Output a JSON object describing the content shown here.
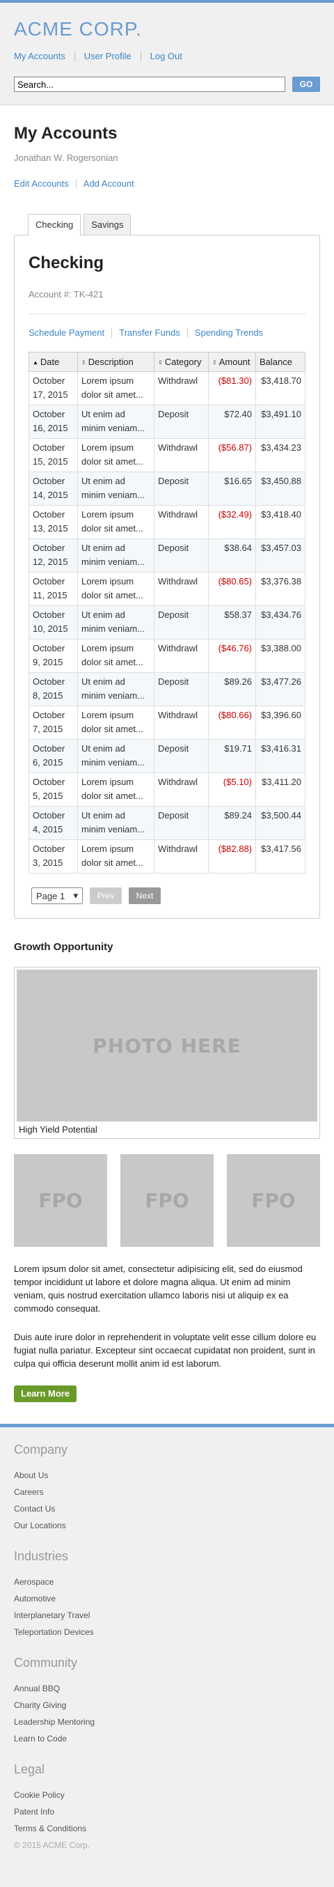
{
  "header": {
    "logo": "ACME CORP.",
    "nav": [
      "My Accounts",
      "User Profile",
      "Log Out"
    ],
    "search_value": "Search...",
    "go_label": "GO"
  },
  "page": {
    "title": "My Accounts",
    "user_name": "Jonathan W. Rogersonian",
    "account_links": [
      "Edit Accounts",
      "Add Account"
    ]
  },
  "tabs": [
    "Checking",
    "Savings"
  ],
  "panel": {
    "title": "Checking",
    "account_number": "Account #: TK-421",
    "links": [
      "Schedule Payment",
      "Transfer Funds",
      "Spending Trends"
    ]
  },
  "table": {
    "columns": [
      "Date",
      "Description",
      "Category",
      "Amount",
      "Balance"
    ],
    "rows": [
      {
        "date": "October 17, 2015",
        "desc": "Lorem ipsum dolor sit amet...",
        "cat": "Withdrawl",
        "amount": "($81.30)",
        "balance": "$3,418.70",
        "neg": true
      },
      {
        "date": "October 16, 2015",
        "desc": "Ut enim ad minim veniam...",
        "cat": "Deposit",
        "amount": "$72.40",
        "balance": "$3,491.10",
        "neg": false
      },
      {
        "date": "October 15, 2015",
        "desc": "Lorem ipsum dolor sit amet...",
        "cat": "Withdrawl",
        "amount": "($56.87)",
        "balance": "$3,434.23",
        "neg": true
      },
      {
        "date": "October 14, 2015",
        "desc": "Ut enim ad minim veniam...",
        "cat": "Deposit",
        "amount": "$16.65",
        "balance": "$3,450.88",
        "neg": false
      },
      {
        "date": "October 13, 2015",
        "desc": "Lorem ipsum dolor sit amet...",
        "cat": "Withdrawl",
        "amount": "($32.49)",
        "balance": "$3,418.40",
        "neg": true
      },
      {
        "date": "October 12, 2015",
        "desc": "Ut enim ad minim veniam...",
        "cat": "Deposit",
        "amount": "$38.64",
        "balance": "$3,457.03",
        "neg": false
      },
      {
        "date": "October 11, 2015",
        "desc": "Lorem ipsum dolor sit amet...",
        "cat": "Withdrawl",
        "amount": "($80.65)",
        "balance": "$3,376.38",
        "neg": true
      },
      {
        "date": "October 10, 2015",
        "desc": "Ut enim ad minim veniam...",
        "cat": "Deposit",
        "amount": "$58.37",
        "balance": "$3,434.76",
        "neg": false
      },
      {
        "date": "October 9, 2015",
        "desc": "Lorem ipsum dolor sit amet...",
        "cat": "Withdrawl",
        "amount": "($46.76)",
        "balance": "$3,388.00",
        "neg": true
      },
      {
        "date": "October 8, 2015",
        "desc": "Ut enim ad minim veniam...",
        "cat": "Deposit",
        "amount": "$89.26",
        "balance": "$3,477.26",
        "neg": false
      },
      {
        "date": "October 7, 2015",
        "desc": "Lorem ipsum dolor sit amet...",
        "cat": "Withdrawl",
        "amount": "($80.66)",
        "balance": "$3,396.60",
        "neg": true
      },
      {
        "date": "October 6, 2015",
        "desc": "Ut enim ad minim veniam...",
        "cat": "Deposit",
        "amount": "$19.71",
        "balance": "$3,416.31",
        "neg": false
      },
      {
        "date": "October 5, 2015",
        "desc": "Lorem ipsum dolor sit amet...",
        "cat": "Withdrawl",
        "amount": "($5.10)",
        "balance": "$3,411.20",
        "neg": true
      },
      {
        "date": "October 4, 2015",
        "desc": "Ut enim ad minim veniam...",
        "cat": "Deposit",
        "amount": "$89.24",
        "balance": "$3,500.44",
        "neg": false
      },
      {
        "date": "October 3, 2015",
        "desc": "Lorem ipsum dolor sit amet...",
        "cat": "Withdrawl",
        "amount": "($82.88)",
        "balance": "$3,417.56",
        "neg": true
      }
    ]
  },
  "pager": {
    "page_value": "Page 1",
    "prev_label": "Prev",
    "next_label": "Next"
  },
  "growth": {
    "title": "Growth Opportunity",
    "photo_text": "PHOTO HERE",
    "caption": "High Yield Potential",
    "fpo": [
      "FPO",
      "FPO",
      "FPO"
    ],
    "para1": "Lorem ipsum dolor sit amet, consectetur adipisicing elit, sed do eiusmod tempor incididunt ut labore et dolore magna aliqua. Ut enim ad minim veniam, quis nostrud exercitation ullamco laboris nisi ut aliquip ex ea commodo consequat.",
    "para2": "Duis aute irure dolor in reprehenderit in voluptate velit esse cillum dolore eu fugiat nulla pariatur. Excepteur sint occaecat cupidatat non proident, sunt in culpa qui officia deserunt mollit anim id est laborum.",
    "learn_label": "Learn More"
  },
  "footer": {
    "columns": [
      {
        "title": "Company",
        "links": [
          "About Us",
          "Careers",
          "Contact Us",
          "Our Locations"
        ]
      },
      {
        "title": "Industries",
        "links": [
          "Aerospace",
          "Automotive",
          "Interplanetary Travel",
          "Teleportation Devices"
        ]
      },
      {
        "title": "Community",
        "links": [
          "Annual BBQ",
          "Charity Giving",
          "Leadership Mentoring",
          "Learn to Code"
        ]
      },
      {
        "title": "Legal",
        "links": [
          "Cookie Policy",
          "Patent Info",
          "Terms & Conditions"
        ]
      }
    ],
    "copyright": "© 2015 ACME Corp."
  },
  "colors": {
    "accent": "#6a9bd1",
    "negative": "#cc0000",
    "learn_button": "#6a9a2a"
  }
}
